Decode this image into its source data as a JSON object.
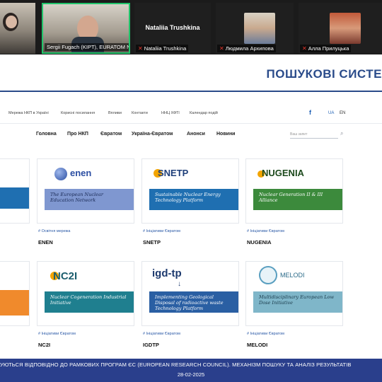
{
  "video": {
    "tiles": [
      {
        "label": ""
      },
      {
        "label": "Sergii Fugach (KIPT), EURATOM NC..."
      },
      {
        "name": "Nataliia Trushkina",
        "label": "Nataliia Trushkina"
      },
      {
        "label": "Людмила Архипова"
      },
      {
        "label": "Алла Прилуцька"
      }
    ]
  },
  "slide": {
    "title": "ПОШУКОВІ СИСТЕ",
    "banner_text": "УЮТЬСЯ ВІДПОВІДНО ДО РАМКОВИХ ПРОГРАМ ЄС (EUROPEAN RESEARCH COUNCIL). МЕХАНІЗМ ПОШУКУ ТА АНАЛІЗ РЕЗУЛЬТАТІВ",
    "date": "28-02-2025"
  },
  "site": {
    "topbar": [
      "Мережа НКП в Україні",
      "Корисні посилання",
      "Впливи",
      "Контакти",
      "ННЦ ХФТІ",
      "Календар подій"
    ],
    "facebook": "f",
    "lang": {
      "ua": "UA",
      "en": "EN"
    },
    "nav": [
      "Головна",
      "Про НКП",
      "Євратом",
      "Україна-Євратом",
      "Анонси",
      "Новини"
    ],
    "search_placeholder": "Ваш запит",
    "cards": [
      {
        "logo": "enen",
        "band": "The European Nuclear Education Network",
        "tag": "# Освітня мережа",
        "name": "ENEN",
        "band_color": "#7f97d0",
        "logo_color": "#2b4ea2"
      },
      {
        "logo": "SNETP",
        "band": "Sustainable Nuclear Energy Technology Platform",
        "tag": "# Ініціативи Євратом",
        "name": "SNETP",
        "band_color": "#1f6fb1",
        "logo_color": "#1f3f7a"
      },
      {
        "logo": "NUGENIA",
        "band": "Nuclear Generation II & III Alliance",
        "tag": "# Ініціативи Євратом",
        "name": "NUGENIA",
        "band_color": "#3c8a3c",
        "logo_color": "#1d4a1d"
      },
      {
        "logo": "NC2I",
        "band": "Nuclear Cogeneration Industrial Initiative",
        "tag": "# Ініціативи Євратом",
        "name": "NC2I",
        "band_color": "#1f7f8f",
        "logo_color": "#1c5e6e"
      },
      {
        "logo": "igd-tp",
        "band": "Implementing Geological Disposal of radioactive waste Technology Platform",
        "tag": "# Ініціативи Євратом",
        "name": "IGDTP",
        "band_color": "#2a5fa3",
        "logo_color": "#1d3a6e"
      },
      {
        "logo": "MELODI",
        "band": "Multidisciplinary European Low Dose Initiative",
        "tag": "# Ініціативи Євратом",
        "name": "MELODI",
        "band_color": "#7fb6c9",
        "logo_color": "#2a6a88"
      }
    ]
  }
}
